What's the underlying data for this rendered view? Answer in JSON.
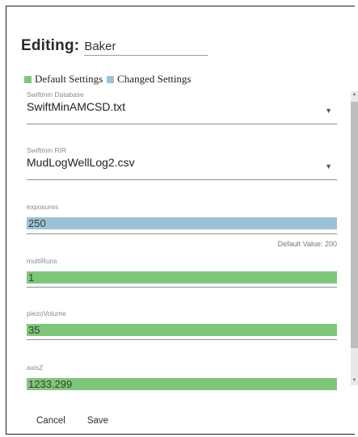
{
  "header": {
    "editing_label": "Editing:",
    "name_value": "Baker"
  },
  "legend": {
    "default": {
      "label": "Default Settings",
      "color": "#7ec77a"
    },
    "changed": {
      "label": "Changed Settings",
      "color": "#9cc3d5"
    }
  },
  "fields": {
    "database": {
      "label": "Swiftmin Database",
      "value": "SwiftMinAMCSD.txt"
    },
    "rir": {
      "label": "Swiftmin RIR",
      "value": "MudLogWellLog2.csv"
    },
    "exposures": {
      "label": "exposures",
      "value": "250",
      "status": "changed",
      "default_hint": "Default Value: 200"
    },
    "multiRuns": {
      "label": "multiRuns",
      "value": "1",
      "status": "default"
    },
    "piezoVolume": {
      "label": "piezoVolume",
      "value": "35",
      "status": "default"
    },
    "axisZ": {
      "label": "axisZ",
      "value": "1233.299",
      "status": "default"
    }
  },
  "icons": {
    "dropdown": "caret-down-icon",
    "scroll_up": "scroll-up-icon",
    "scroll_down": "scroll-down-icon"
  },
  "actions": {
    "cancel": "Cancel",
    "save": "Save"
  }
}
